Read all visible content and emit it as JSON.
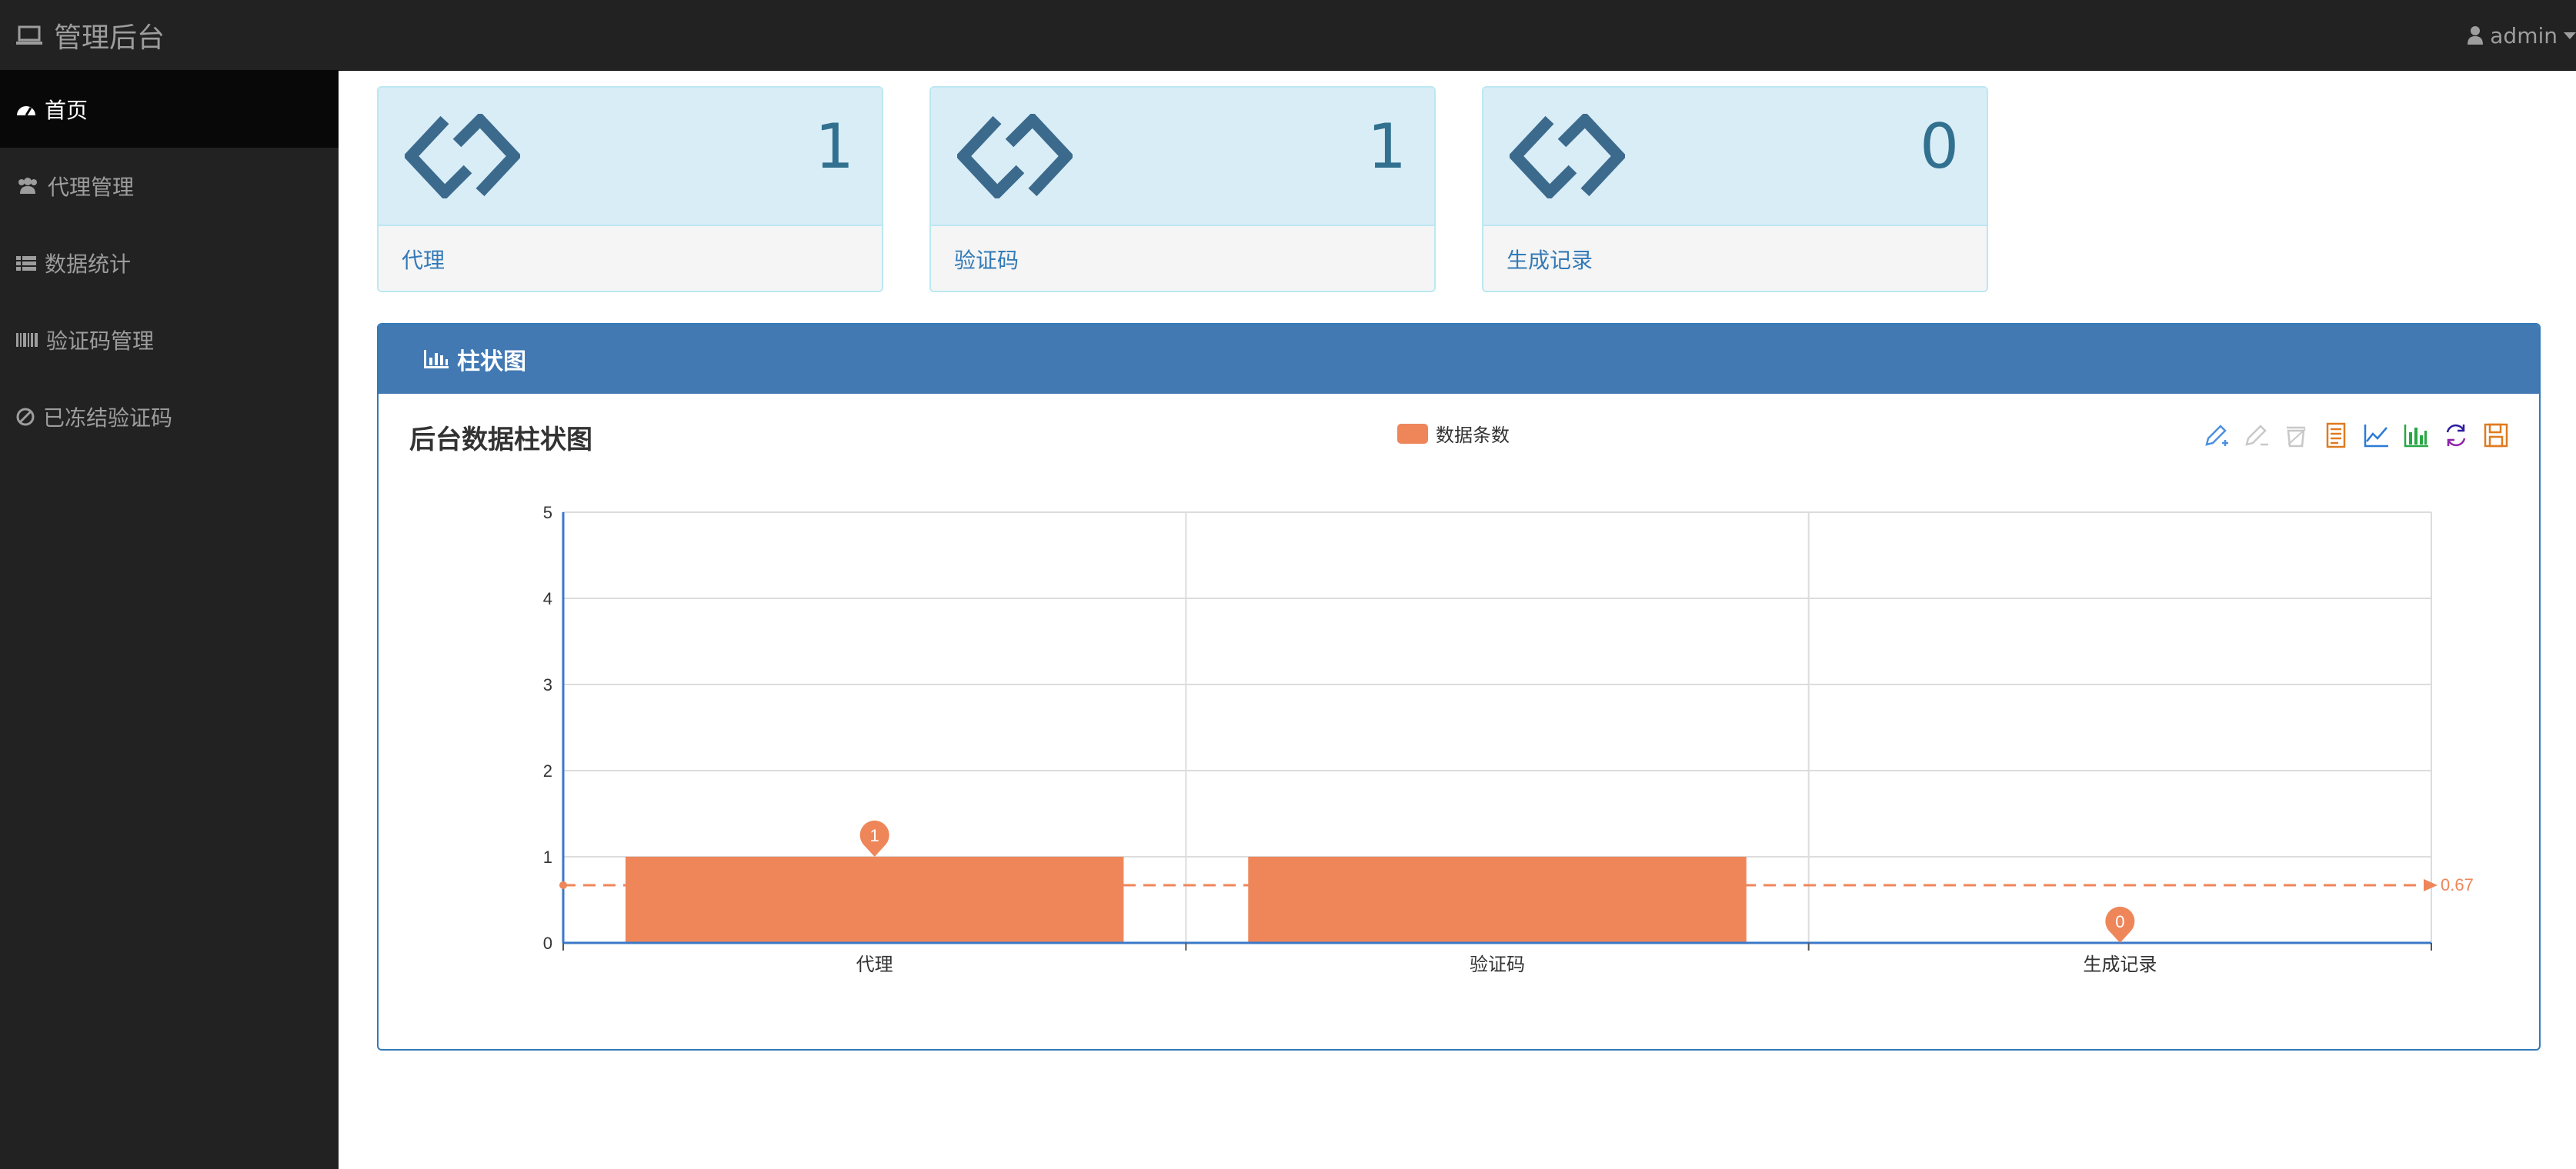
{
  "header": {
    "brand": "管理后台",
    "user": "admin"
  },
  "sidebar": {
    "items": [
      {
        "label": "首页",
        "icon": "dashboard-icon",
        "active": true
      },
      {
        "label": "代理管理",
        "icon": "users-icon",
        "active": false
      },
      {
        "label": "数据统计",
        "icon": "list-icon",
        "active": false
      },
      {
        "label": "验证码管理",
        "icon": "barcode-icon",
        "active": false
      },
      {
        "label": "已冻结验证码",
        "icon": "ban-icon",
        "active": false
      }
    ]
  },
  "cards": [
    {
      "count": "1",
      "label": "代理"
    },
    {
      "count": "1",
      "label": "验证码"
    },
    {
      "count": "0",
      "label": "生成记录"
    }
  ],
  "panel": {
    "title": "柱状图"
  },
  "colors": {
    "bar": "#ee865a",
    "panel": "#4279b3",
    "card_bg": "#d9edf7"
  },
  "chart_data": {
    "type": "bar",
    "title": "后台数据柱状图",
    "legend": [
      "数据条数"
    ],
    "categories": [
      "代理",
      "验证码",
      "生成记录"
    ],
    "series": [
      {
        "name": "数据条数",
        "values": [
          1,
          1,
          0
        ]
      }
    ],
    "ylim": [
      0,
      5
    ],
    "yticks": [
      "0",
      "1",
      "2",
      "3",
      "4",
      "5"
    ],
    "mark_points": [
      "1",
      "0"
    ],
    "average_line": {
      "value": 0.67,
      "label": "0.67"
    },
    "grid": true,
    "toolbox": [
      "mark-icon",
      "mark-undo-icon",
      "mark-clear-icon",
      "data-view-icon",
      "line-chart-icon",
      "bar-chart-icon",
      "restore-icon",
      "save-image-icon"
    ]
  }
}
